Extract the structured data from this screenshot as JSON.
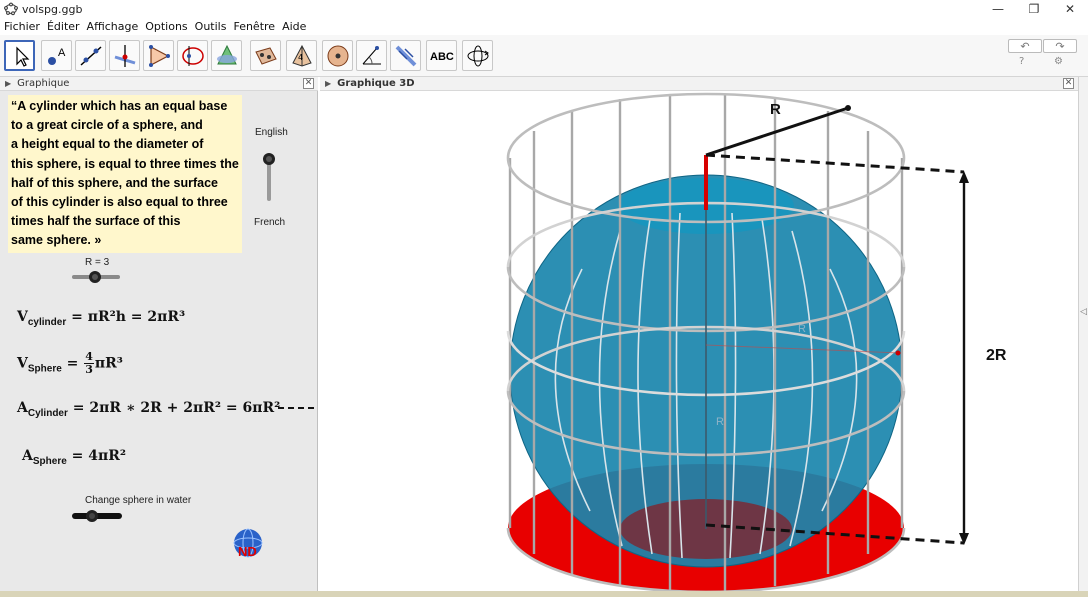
{
  "window": {
    "title": "volspg.ggb",
    "controls": {
      "minimize": "—",
      "restore": "❐",
      "close": "✕"
    }
  },
  "menu": [
    "Fichier",
    "Éditer",
    "Affichage",
    "Options",
    "Outils",
    "Fenêtre",
    "Aide"
  ],
  "toolbar": {
    "tools": [
      {
        "name": "move-tool-icon",
        "active": true
      },
      {
        "name": "point-tool-icon"
      },
      {
        "name": "line-tool-icon"
      },
      {
        "name": "perpendicular-line-tool-icon"
      },
      {
        "name": "polygon-tool-icon"
      },
      {
        "name": "circle-tool-icon"
      },
      {
        "name": "intersect-tool-icon"
      },
      {
        "name": "plane-tool-icon"
      },
      {
        "name": "pyramid-tool-icon"
      },
      {
        "name": "sphere-tool-icon"
      },
      {
        "name": "angle-tool-icon"
      },
      {
        "name": "reflect-tool-icon"
      },
      {
        "name": "text-tool-icon",
        "label": "ABC"
      },
      {
        "name": "rotate-view-tool-icon"
      }
    ],
    "undo": "↶",
    "redo": "↷",
    "help": "?",
    "settings": "⚙"
  },
  "graphics_panel": {
    "title": "Graphique",
    "quote_lines": [
      "“A cylinder which has an equal base",
      "to a great circle of a sphere, and",
      "a height equal to the diameter of",
      "this sphere, is equal to three times the",
      "half of this sphere, and the surface",
      "of this cylinder is also equal to three",
      "times half the surface of this",
      "same sphere. »"
    ],
    "lang_top": "English",
    "lang_bottom": "French",
    "slider_label": "R = 3",
    "formulas": {
      "v_cyl": {
        "lhs": "V",
        "sub": "cylinder",
        "rhs": "= πR²h = 2πR³"
      },
      "v_sph": {
        "lhs": "V",
        "sub": "Sphere",
        "eq": "=",
        "num": "4",
        "den": "3",
        "rest": "πR³"
      },
      "a_cyl": {
        "lhs": "A",
        "sub": "Cylinder",
        "rhs": "= 2πR ∗ 2R + 2πR² = 6πR²"
      },
      "a_sph": {
        "lhs": "A",
        "sub": "Sphere",
        "rhs": "= 4πR²"
      }
    },
    "water_label": "Change sphere in water",
    "logo_text": "ND"
  },
  "view3d": {
    "title": "Graphique 3D",
    "label_R": "R",
    "label_2R": "2R",
    "faint_labels": [
      "R",
      "R"
    ]
  },
  "colors": {
    "sphere": "#1a86ad",
    "base": "#e50000",
    "quote_bg": "#fff7cc",
    "active_tool": "#3d66b8"
  }
}
